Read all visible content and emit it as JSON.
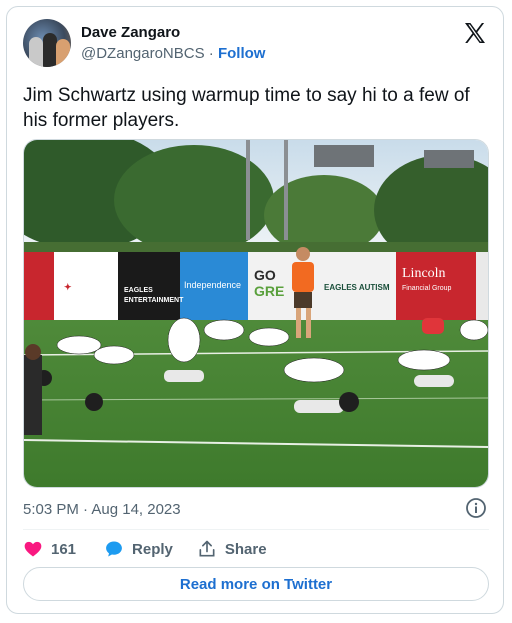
{
  "author": {
    "name": "Dave Zangaro",
    "handle": "@DZangaroNBCS",
    "separator": "·",
    "follow_label": "Follow"
  },
  "tweet": {
    "text": "Jim Schwartz using warmup time to say hi to a few of his former players."
  },
  "media": {
    "banners": [
      {
        "text": "Lincoln",
        "color": "#c8262e"
      },
      {
        "text": "EAGLES ENTERTAINMENT",
        "color": "#1a1a1a"
      },
      {
        "text": "Independence",
        "color": "#2a8ad6"
      },
      {
        "text": "GO GREEN",
        "color": "#f2f2f2"
      },
      {
        "text": "EAGLES AUTISM FOUNDATION",
        "color": "#f2f2f2"
      },
      {
        "text": "Lincoln Financial Group",
        "color": "#c8262e"
      }
    ]
  },
  "meta": {
    "timestamp": "5:03 PM · Aug 14, 2023"
  },
  "actions": {
    "like_count": "161",
    "reply_label": "Reply",
    "share_label": "Share"
  },
  "cta": {
    "read_more_label": "Read more on Twitter"
  },
  "colors": {
    "like": "#f91880",
    "reply": "#1d9bf0",
    "link": "#1d6fd0"
  },
  "icons": [
    "x-logo-icon",
    "info-icon",
    "heart-icon",
    "reply-bubble-icon",
    "share-icon"
  ]
}
